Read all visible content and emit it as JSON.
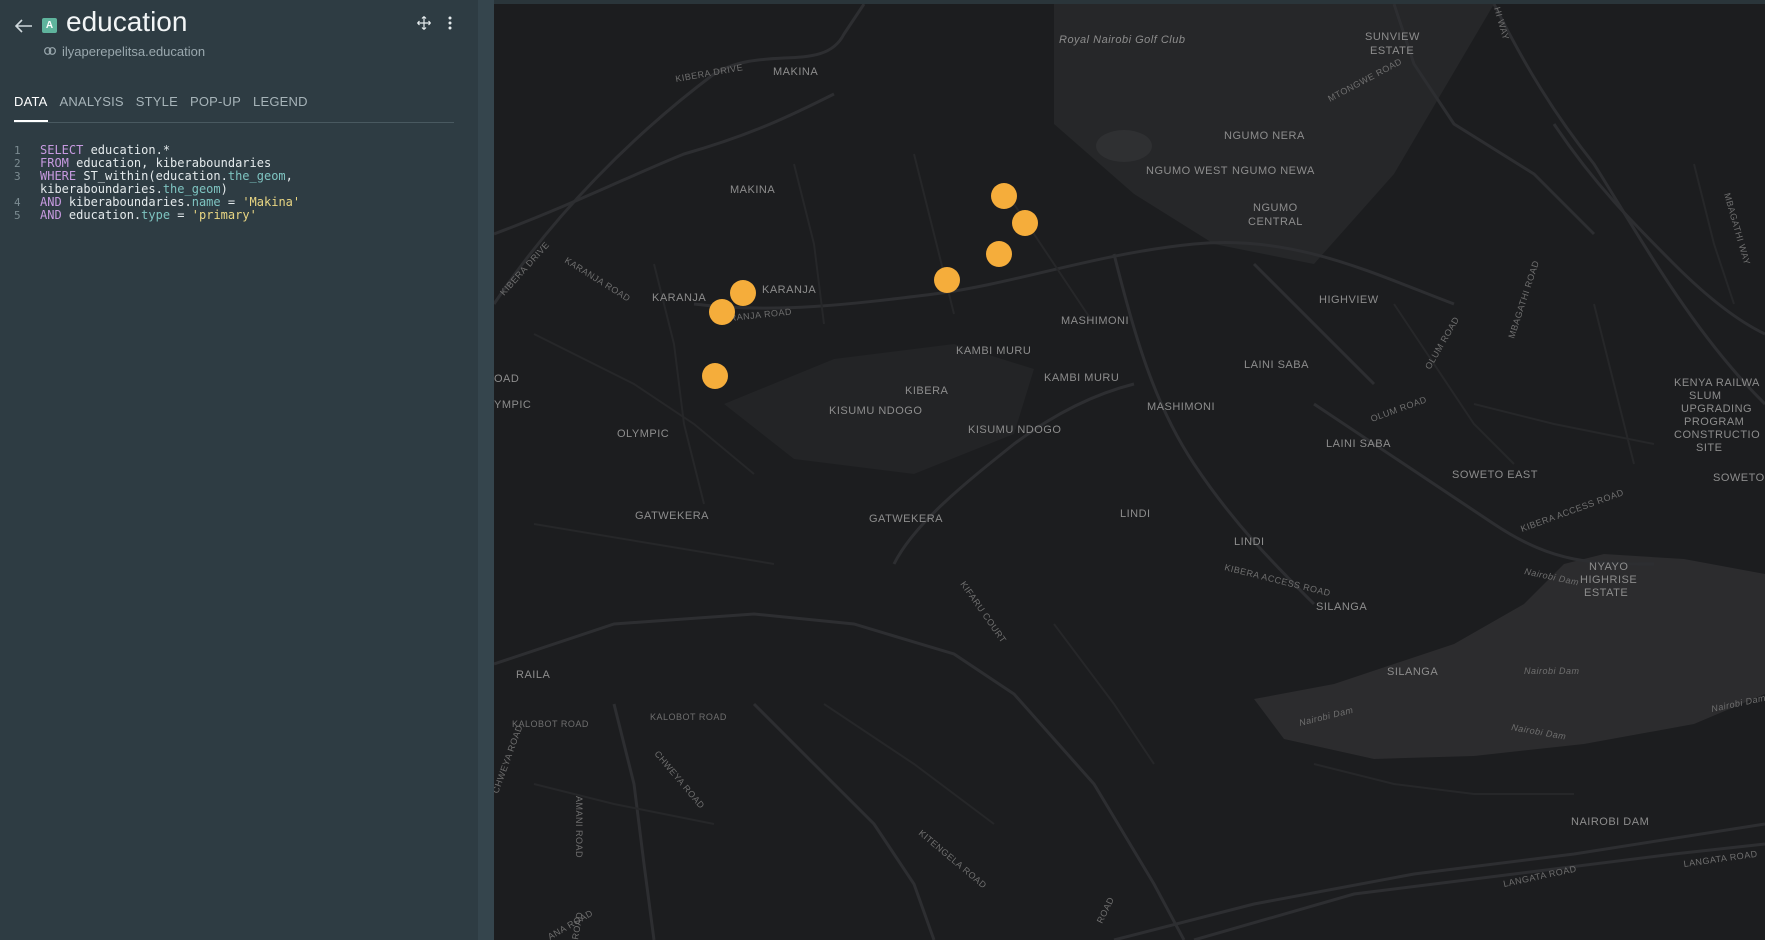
{
  "header": {
    "title": "education",
    "subtitle": "ilyaperepelitsa.education",
    "layer_badge": "A"
  },
  "tabs": [
    {
      "label": "DATA",
      "active": true
    },
    {
      "label": "ANALYSIS",
      "active": false
    },
    {
      "label": "STYLE",
      "active": false
    },
    {
      "label": "POP-UP",
      "active": false
    },
    {
      "label": "LEGEND",
      "active": false
    }
  ],
  "query": {
    "line_numbers": [
      "1",
      "2",
      "3",
      "4",
      "5"
    ],
    "line1": {
      "kw": "SELECT",
      "rest": " education.*"
    },
    "line2": {
      "kw": "FROM",
      "rest": " education, kiberaboundaries"
    },
    "line3": {
      "kw": "WHERE",
      "a": " ST_within(education.",
      "f1": "the_geom",
      "b": ",",
      "c": "kiberaboundaries.",
      "f2": "the_geom",
      "d": ")"
    },
    "line4": {
      "kw": "AND",
      "a": " kiberaboundaries.",
      "f": "name",
      "b": " = ",
      "s": "'Makina'"
    },
    "line5": {
      "kw": "AND",
      "a": " education.",
      "f": "type",
      "b": " = ",
      "s": "'primary'"
    }
  },
  "map": {
    "marker_color": "#f5ad3b",
    "labels": {
      "golf": "Royal Nairobi Golf Club",
      "sunview1": "SUNVIEW",
      "sunview2": "ESTATE",
      "kibera_drive": "KIBERA DRIVE",
      "kibera_drive2": "KIBERA DRIVE",
      "makina1": "MAKINA",
      "makina2": "MAKINA",
      "ngumo_nera": "NGUMO NERA",
      "ngumo_west": "NGUMO WEST",
      "ngumo_newa": "NGUMO NEWA",
      "ngumo_central1": "NGUMO",
      "ngumo_central2": "CENTRAL",
      "mtongwe": "MTONGWE ROAD",
      "karanja1": "KARANJA",
      "karanja2": "KARANJA",
      "karanja_road": "KARANJA ROAD",
      "karanja_road2": "RANJA ROAD",
      "highview": "HIGHVIEW",
      "mashimoni1": "MASHIMONI",
      "mashimoni2": "MASHIMONI",
      "kambi_muru1": "KAMBI MURU",
      "kambi_muru2": "KAMBI MURU",
      "laini_saba1": "LAINI SABA",
      "laini_saba2": "LAINI SABA",
      "kibera": "KIBERA",
      "kisumu1": "KISUMU NDOGO",
      "kisumu2": "KISUMU NDOGO",
      "olympic1": "OLYMPIC",
      "olympic2": "YMPIC",
      "road_cut": "OAD",
      "kenya1": "KENYA RAILWA",
      "kenya2": "SLUM",
      "kenya3": "UPGRADING",
      "kenya4": "PROGRAM",
      "kenya5": "CONSTRUCTIO",
      "kenya6": "SITE",
      "soweto_east": "SOWETO EAST",
      "soweto": "SOWETO",
      "gatwekera1": "GATWEKERA",
      "gatwekera2": "GATWEKERA",
      "lindi1": "LINDI",
      "lindi2": "LINDI",
      "kibera_access": "KIBERA ACCESS ROAD",
      "kibera_access2": "KIBERA ACCESS ROAD",
      "nyayo1": "NYAYO",
      "nyayo2": "HIGHRISE",
      "nyayo3": "ESTATE",
      "silanga1": "SILANGA",
      "silanga2": "SILANGA",
      "kifaru": "KIFARU COURT",
      "raila": "RAILA",
      "kalobot1": "KALOBOT ROAD",
      "kalobot2": "KALOBOT ROAD",
      "chweya1": "CHWEYA ROAD",
      "chweya2": "CHWEYA ROAD",
      "amani": "AMANI ROAD",
      "kitengela": "KITENGELA ROAD",
      "nairobi_dam": "NAIROBI DAM",
      "dam1": "Nairobi Dam",
      "dam2": "Nairobi Dam",
      "dam3": "Nairobi Dam",
      "dam4": "Nairobi Dam",
      "dam5": "Nairobi Dam",
      "langata1": "LANGATA ROAD",
      "langata2": "LANGATA ROAD",
      "olum1": "OLUM ROAD",
      "olum2": "OLUM ROAD",
      "mbagathi": "MBAGATHI ROAD",
      "mbagathi_way": "MBAGATHI WAY",
      "hi_way": "HI WAY",
      "road_bottom": "ROAD",
      "ana_road": "ANA ROAD"
    }
  }
}
